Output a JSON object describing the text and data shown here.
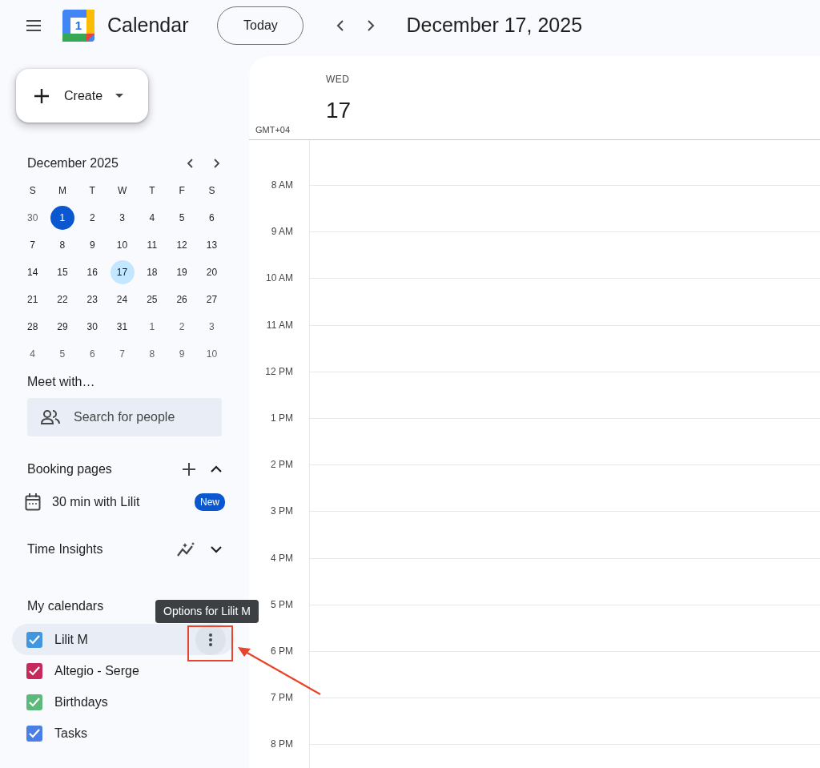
{
  "app_bar": {
    "logo_digit": "1",
    "title": "Calendar",
    "today_button": "Today",
    "date_title": "December 17, 2025"
  },
  "create_button": {
    "label": "Create"
  },
  "mini_calendar": {
    "title": "December 2025",
    "weekdays": [
      "S",
      "M",
      "T",
      "W",
      "T",
      "F",
      "S"
    ],
    "weeks": [
      [
        {
          "day": "30",
          "outside": true,
          "today": false,
          "selected": false
        },
        {
          "day": "1",
          "outside": false,
          "today": true,
          "selected": false
        },
        {
          "day": "2",
          "outside": false,
          "today": false,
          "selected": false
        },
        {
          "day": "3",
          "outside": false,
          "today": false,
          "selected": false
        },
        {
          "day": "4",
          "outside": false,
          "today": false,
          "selected": false
        },
        {
          "day": "5",
          "outside": false,
          "today": false,
          "selected": false
        },
        {
          "day": "6",
          "outside": false,
          "today": false,
          "selected": false
        }
      ],
      [
        {
          "day": "7",
          "outside": false,
          "today": false,
          "selected": false
        },
        {
          "day": "8",
          "outside": false,
          "today": false,
          "selected": false
        },
        {
          "day": "9",
          "outside": false,
          "today": false,
          "selected": false
        },
        {
          "day": "10",
          "outside": false,
          "today": false,
          "selected": false
        },
        {
          "day": "11",
          "outside": false,
          "today": false,
          "selected": false
        },
        {
          "day": "12",
          "outside": false,
          "today": false,
          "selected": false
        },
        {
          "day": "13",
          "outside": false,
          "today": false,
          "selected": false
        }
      ],
      [
        {
          "day": "14",
          "outside": false,
          "today": false,
          "selected": false
        },
        {
          "day": "15",
          "outside": false,
          "today": false,
          "selected": false
        },
        {
          "day": "16",
          "outside": false,
          "today": false,
          "selected": false
        },
        {
          "day": "17",
          "outside": false,
          "today": false,
          "selected": true
        },
        {
          "day": "18",
          "outside": false,
          "today": false,
          "selected": false
        },
        {
          "day": "19",
          "outside": false,
          "today": false,
          "selected": false
        },
        {
          "day": "20",
          "outside": false,
          "today": false,
          "selected": false
        }
      ],
      [
        {
          "day": "21",
          "outside": false,
          "today": false,
          "selected": false
        },
        {
          "day": "22",
          "outside": false,
          "today": false,
          "selected": false
        },
        {
          "day": "23",
          "outside": false,
          "today": false,
          "selected": false
        },
        {
          "day": "24",
          "outside": false,
          "today": false,
          "selected": false
        },
        {
          "day": "25",
          "outside": false,
          "today": false,
          "selected": false
        },
        {
          "day": "26",
          "outside": false,
          "today": false,
          "selected": false
        },
        {
          "day": "27",
          "outside": false,
          "today": false,
          "selected": false
        }
      ],
      [
        {
          "day": "28",
          "outside": false,
          "today": false,
          "selected": false
        },
        {
          "day": "29",
          "outside": false,
          "today": false,
          "selected": false
        },
        {
          "day": "30",
          "outside": false,
          "today": false,
          "selected": false
        },
        {
          "day": "31",
          "outside": false,
          "today": false,
          "selected": false
        },
        {
          "day": "1",
          "outside": true,
          "today": false,
          "selected": false
        },
        {
          "day": "2",
          "outside": true,
          "today": false,
          "selected": false
        },
        {
          "day": "3",
          "outside": true,
          "today": false,
          "selected": false
        }
      ],
      [
        {
          "day": "4",
          "outside": true,
          "today": false,
          "selected": false
        },
        {
          "day": "5",
          "outside": true,
          "today": false,
          "selected": false
        },
        {
          "day": "6",
          "outside": true,
          "today": false,
          "selected": false
        },
        {
          "day": "7",
          "outside": true,
          "today": false,
          "selected": false
        },
        {
          "day": "8",
          "outside": true,
          "today": false,
          "selected": false
        },
        {
          "day": "9",
          "outside": true,
          "today": false,
          "selected": false
        },
        {
          "day": "10",
          "outside": true,
          "today": false,
          "selected": false
        }
      ]
    ]
  },
  "meet_with": {
    "title": "Meet with…",
    "search": {
      "placeholder": "Search for people"
    }
  },
  "booking_pages": {
    "title": "Booking pages",
    "expanded": true,
    "items": [
      {
        "label": "30 min with Lilit",
        "badge": "New"
      }
    ]
  },
  "time_insights": {
    "title": "Time Insights",
    "expanded": false
  },
  "my_calendars": {
    "title": "My calendars",
    "tooltip": "Options for Lilit M",
    "items": [
      {
        "label": "Lilit M",
        "checked": true,
        "color": "#4296e0",
        "hovered": true
      },
      {
        "label": "Altegio - Serge",
        "checked": true,
        "color": "#c8295c",
        "hovered": false
      },
      {
        "label": "Birthdays",
        "checked": true,
        "color": "#5cb97a",
        "hovered": false
      },
      {
        "label": "Tasks",
        "checked": true,
        "color": "#4b7fe8",
        "hovered": false
      }
    ]
  },
  "day_view": {
    "weekday": "WED",
    "day": "17",
    "timezone": "GMT+04",
    "hours": [
      "8 AM",
      "9 AM",
      "10 AM",
      "11 AM",
      "12 PM",
      "1 PM",
      "2 PM",
      "3 PM",
      "4 PM",
      "5 PM",
      "6 PM",
      "7 PM",
      "8 PM"
    ]
  }
}
